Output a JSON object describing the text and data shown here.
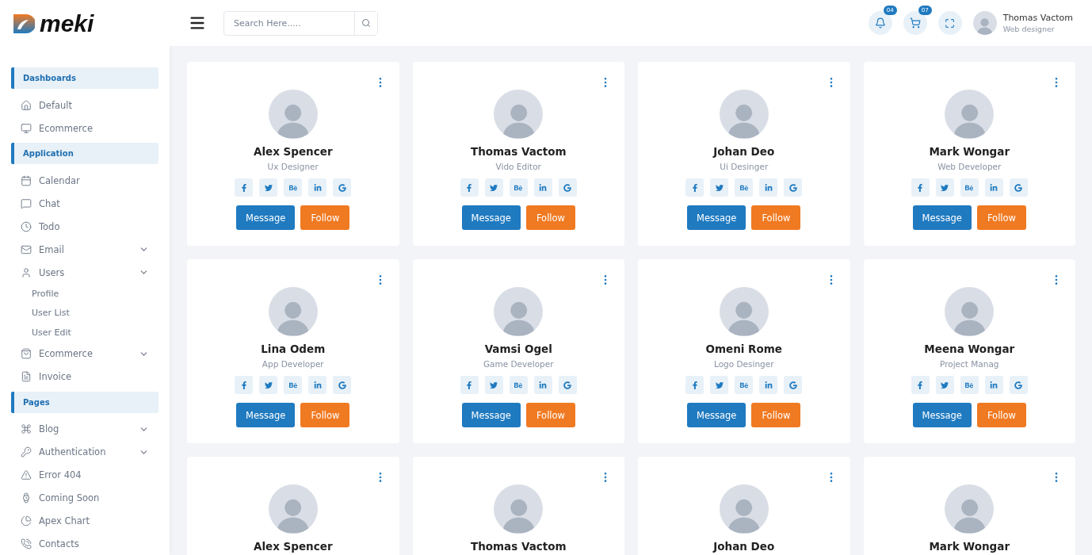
{
  "brand": {
    "name": "meki"
  },
  "search": {
    "placeholder": "Search Here....."
  },
  "header": {
    "notifications": "04",
    "cart": "07",
    "user": {
      "name": "Thomas Vactom",
      "role": "Web designer"
    }
  },
  "sidebar": {
    "sections": [
      {
        "title": "Dashboards",
        "items": [
          {
            "label": "Default",
            "expandable": false
          },
          {
            "label": "Ecommerce",
            "expandable": false
          }
        ]
      },
      {
        "title": "Application",
        "items": [
          {
            "label": "Calendar",
            "expandable": false
          },
          {
            "label": "Chat",
            "expandable": false
          },
          {
            "label": "Todo",
            "expandable": false
          },
          {
            "label": "Email",
            "expandable": true
          },
          {
            "label": "Users",
            "expandable": true,
            "children": [
              {
                "label": "Profile"
              },
              {
                "label": "User List"
              },
              {
                "label": "User Edit"
              }
            ]
          },
          {
            "label": "Ecommerce",
            "expandable": true
          },
          {
            "label": "Invoice",
            "expandable": false
          }
        ]
      },
      {
        "title": "Pages",
        "items": [
          {
            "label": "Blog",
            "expandable": true
          },
          {
            "label": "Authentication",
            "expandable": true
          },
          {
            "label": "Error 404",
            "expandable": false
          },
          {
            "label": "Coming Soon",
            "expandable": false
          },
          {
            "label": "Apex Chart",
            "expandable": false
          },
          {
            "label": "Contacts",
            "expandable": false
          }
        ]
      }
    ]
  },
  "cards": [
    {
      "name": "Alex Spencer",
      "role": "Ux Designer",
      "message": "Message",
      "follow": "Follow"
    },
    {
      "name": "Thomas Vactom",
      "role": "Vido Editor",
      "message": "Message",
      "follow": "Follow"
    },
    {
      "name": "Johan Deo",
      "role": "Ui Desinger",
      "message": "Message",
      "follow": "Follow"
    },
    {
      "name": "Mark Wongar",
      "role": "Web Developer",
      "message": "Message",
      "follow": "Follow"
    },
    {
      "name": "Lina Odem",
      "role": "App Developer",
      "message": "Message",
      "follow": "Follow"
    },
    {
      "name": "Vamsi Ogel",
      "role": "Game Developer",
      "message": "Message",
      "follow": "Follow"
    },
    {
      "name": "Omeni Rome",
      "role": "Logo Desinger",
      "message": "Message",
      "follow": "Follow"
    },
    {
      "name": "Meena Wongar",
      "role": "Project Manag",
      "message": "Message",
      "follow": "Follow"
    },
    {
      "name": "Alex Spencer"
    },
    {
      "name": "Thomas Vactom"
    },
    {
      "name": "Johan Deo"
    },
    {
      "name": "Mark Wongar"
    }
  ]
}
